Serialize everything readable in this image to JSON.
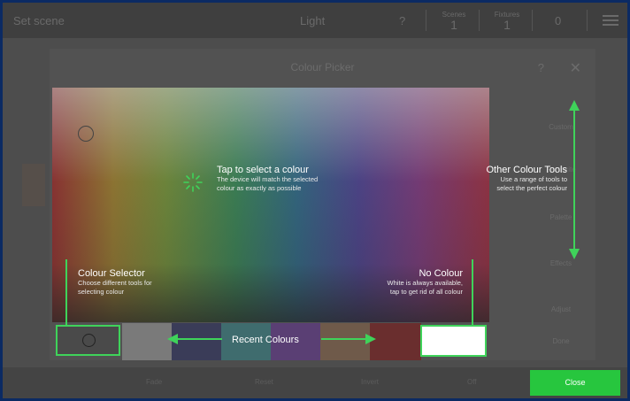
{
  "topbar": {
    "left_label": "Set scene",
    "center_label": "Light",
    "help": "?",
    "counter1": {
      "label": "Scenes",
      "value": "1"
    },
    "counter2": {
      "label": "Fixtures",
      "value": "1"
    },
    "extra": "0"
  },
  "dialog": {
    "title": "Colour Picker",
    "help": "?",
    "close": "✕",
    "side_buttons": [
      "Custom",
      "Favourite",
      "Palette",
      "Effects",
      "Adjust",
      "Done"
    ]
  },
  "bottombar": {
    "items": [
      "Fade",
      "Reset",
      "Invert",
      "Off"
    ],
    "close_label": "Close"
  },
  "annotations": {
    "tap": {
      "title": "Tap to select a colour",
      "sub1": "The device will match the selected",
      "sub2": "colour as exactly as possible"
    },
    "other": {
      "title": "Other Colour Tools",
      "sub1": "Use a range of tools to",
      "sub2": "select the perfect colour"
    },
    "selector": {
      "title": "Colour Selector",
      "sub1": "Choose different tools for",
      "sub2": "selecting colour"
    },
    "nocolour": {
      "title": "No Colour",
      "sub1": "White is always available,",
      "sub2": "tap to get rid of all colour"
    },
    "recent": "Recent Colours"
  },
  "colors": {
    "accent": "#3fd35a",
    "swatches": [
      "#7a7a7a",
      "#3a3c58",
      "#3f6c6e",
      "#5a3f74",
      "#6f5a4a",
      "#6a2e2e"
    ]
  },
  "icons": {
    "tap": "tap-burst-icon",
    "selector": "colour-ring-icon",
    "close": "close-icon",
    "menu": "hamburger-icon"
  }
}
